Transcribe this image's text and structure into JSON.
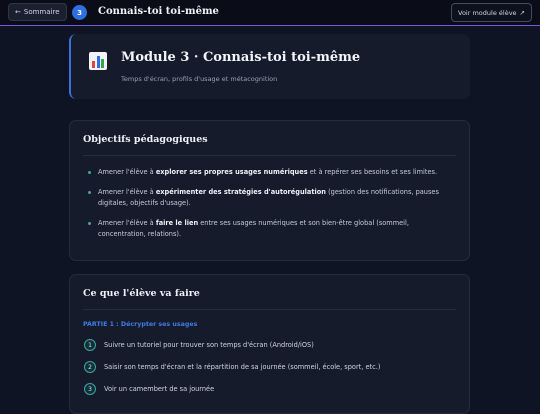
{
  "topbar": {
    "back_label": "Sommaire",
    "module_number": "3",
    "title": "Connais-toi toi-même",
    "view_button_label": "Voir module élève"
  },
  "hero": {
    "icon": "bar-chart-icon",
    "title": "Module 3 · Connais-toi toi-même",
    "subtitle": "Temps d'écran, profils d'usage et métacognition"
  },
  "objectives": {
    "title": "Objectifs pédagogiques",
    "items": [
      {
        "pre": "Amener l'élève à ",
        "bold": "explorer ses propres usages numériques",
        "post": " et à repérer ses besoins et ses limites."
      },
      {
        "pre": "Amener l'élève à ",
        "bold": "expérimenter des stratégies d'autorégulation",
        "post": " (gestion des notifications, pauses digitales, objectifs d'usage)."
      },
      {
        "pre": "Amener l'élève à ",
        "bold": "faire le lien",
        "post": " entre ses usages numériques et son bien-être global (sommeil, concentration, relations)."
      }
    ]
  },
  "activities": {
    "title": "Ce que l'élève va faire",
    "part_label": "PARTIE 1 : Décrypter ses usages",
    "steps": [
      {
        "number": "1",
        "text": "Suivre un tutoriel pour trouver son temps d'écran (Android/iOS)"
      },
      {
        "number": "2",
        "text": "Saisir son temps d'écran et la répartition de sa journée (sommeil, école, sport, etc.)"
      },
      {
        "number": "3",
        "text": "Voir un camembert de sa journée"
      }
    ]
  },
  "colors": {
    "accent_blue": "#2f6fe0",
    "accent_teal": "#3aa6a0",
    "accent_purple": "#7a5bd6",
    "background": "#0f1424"
  }
}
